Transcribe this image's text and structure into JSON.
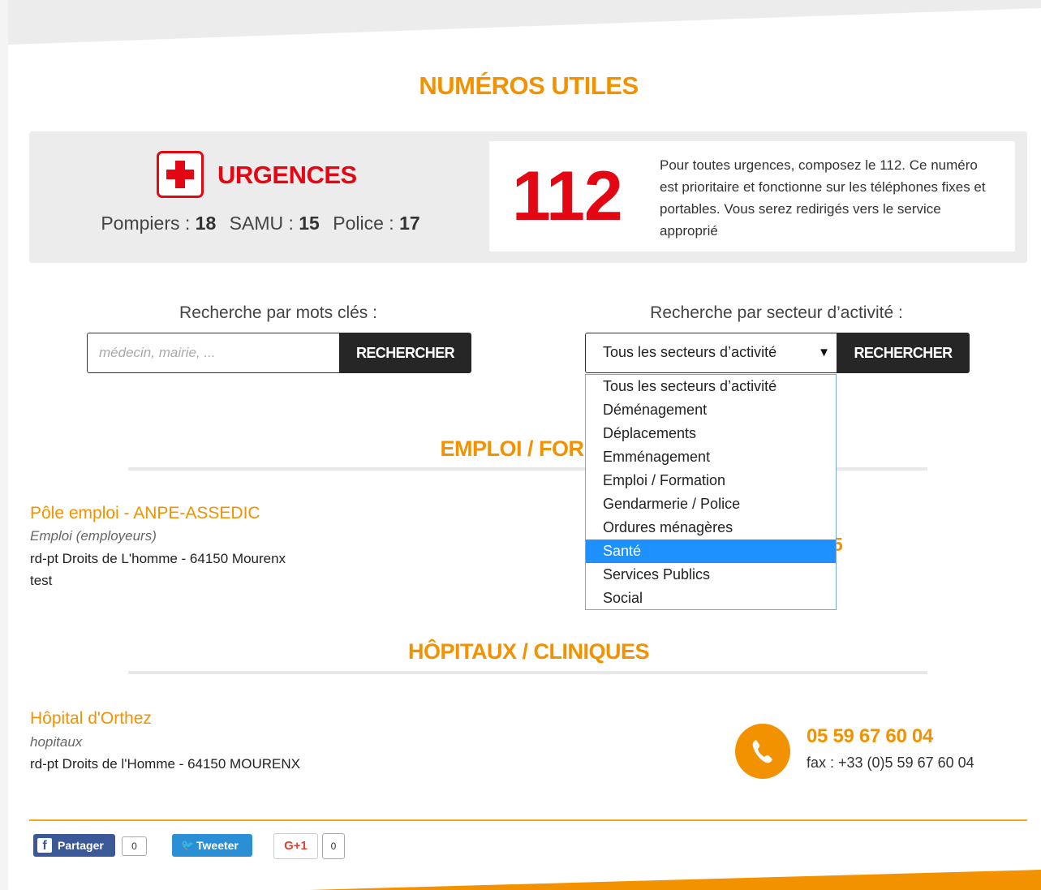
{
  "page": {
    "title": "NUMÉROS UTILES"
  },
  "urgences": {
    "title": "URGENCES",
    "services": [
      {
        "label": "Pompiers :",
        "number": "18"
      },
      {
        "label": "SAMU :",
        "number": "15"
      },
      {
        "label": "Police :",
        "number": "17"
      }
    ],
    "big_number": "112",
    "description": "Pour toutes urgences, composez le 112. Ce numéro est prioritaire et fonctionne sur les téléphones fixes et portables. Vous serez redirigés vers le service approprié"
  },
  "search": {
    "keyword_label": "Recherche par mots clés :",
    "keyword_placeholder": "médecin, mairie, ...",
    "keyword_button": "RECHERCHER",
    "sector_label": "Recherche par secteur d’activité :",
    "sector_selected": "Tous les secteurs d’activité",
    "sector_button": "RECHERCHER",
    "sector_options": [
      "Tous les secteurs d’activité",
      "Déménagement",
      "Déplacements",
      "Emménagement",
      "Emploi / Formation",
      "Gendarmerie / Police",
      "Ordures ménagères",
      "Santé",
      "Services Publics",
      "Social"
    ],
    "highlighted_option": "Santé"
  },
  "sections": [
    {
      "title": "EMPLOI / FORMA",
      "entries": [
        {
          "name": "Pôle emploi - ANPE-ASSEDIC",
          "category": "Emploi (employeurs)",
          "address": "rd-pt Droits de L'homme - 64150 Mourenx",
          "note": "test",
          "phone_partial": "5"
        }
      ]
    },
    {
      "title": "HÔPITAUX / CLINIQUES",
      "entries": [
        {
          "name": "Hôpital d'Orthez",
          "category": "hopitaux",
          "address": "rd-pt Droits de l'Homme - 64150 MOURENX",
          "phone": "05 59 67 60 04",
          "fax": "fax : +33 (0)5 59 67 60 04"
        }
      ]
    }
  ],
  "share": {
    "facebook_label": "Partager",
    "facebook_count": "0",
    "twitter_label": "Tweeter",
    "gplus_label": "G+1",
    "gplus_count": "0"
  },
  "colors": {
    "accent": "#f39200",
    "emergency_red": "#e30613",
    "button_dark": "#262626",
    "panel_grey": "#ececec",
    "dropdown_highlight": "#1e90ff",
    "facebook": "#3b5998",
    "twitter": "#2b8fd6"
  }
}
